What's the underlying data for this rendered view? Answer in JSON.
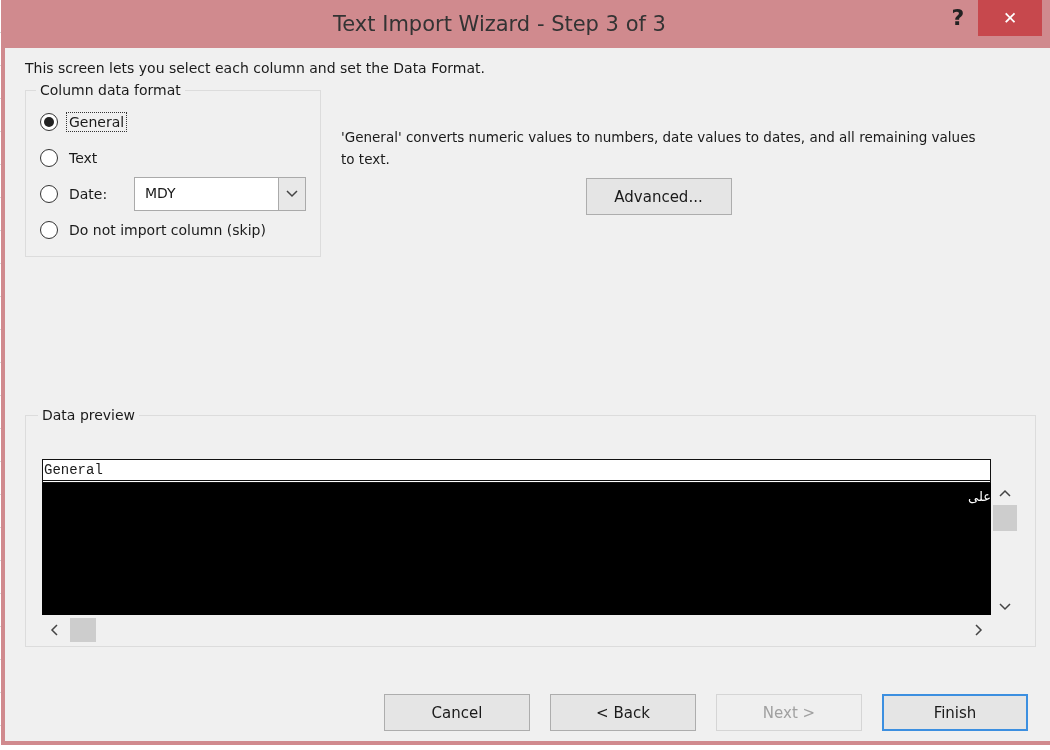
{
  "window": {
    "title": "Text Import Wizard - Step 3 of 3",
    "help": "?",
    "close": "✕"
  },
  "intro": "This screen lets you select each column and set the Data Format.",
  "column_format": {
    "legend": "Column data format",
    "options": [
      {
        "label": "General",
        "selected": true
      },
      {
        "label": "Text",
        "selected": false
      },
      {
        "label": "Date:",
        "selected": false,
        "kind": "date",
        "value": "MDY"
      },
      {
        "label": "Do not import column (skip)",
        "selected": false
      }
    ]
  },
  "description": "'General' converts numeric values to numbers, date values to dates, and all remaining values to text.",
  "advanced_button": "Advanced...",
  "preview": {
    "legend": "Data preview",
    "header": "General",
    "rows": [
      "على"
    ]
  },
  "buttons": [
    {
      "label": "Cancel",
      "disabled": false,
      "default": false
    },
    {
      "label": "< Back",
      "disabled": false,
      "default": false
    },
    {
      "label": "Next >",
      "disabled": true,
      "default": false
    },
    {
      "label": "Finish",
      "disabled": false,
      "default": true
    }
  ]
}
